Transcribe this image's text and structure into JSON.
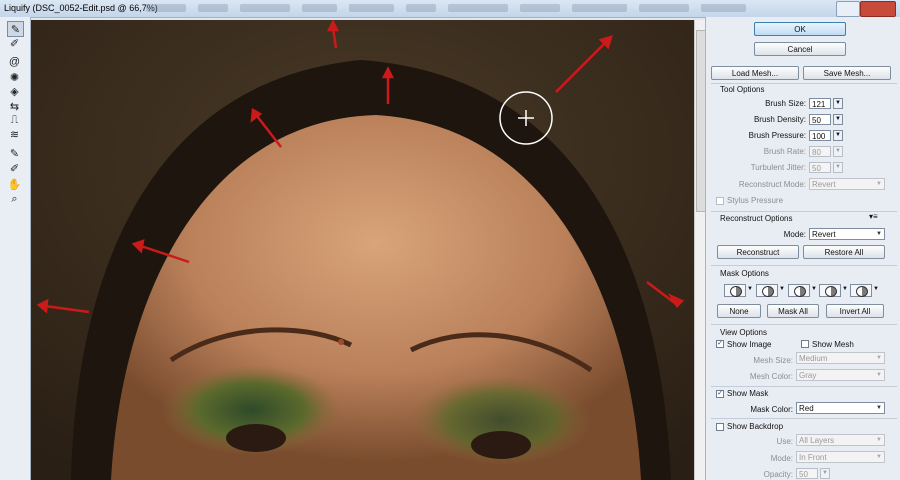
{
  "window": {
    "title": "Liquify (DSC_0052-Edit.psd @ 66,7%)"
  },
  "tools": [
    "forward-warp-icon",
    "reconstruct-icon",
    "twirl-icon",
    "pucker-icon",
    "bloat-icon",
    "push-left-icon",
    "mirror-icon",
    "turbulence-icon",
    "freeze-mask-icon",
    "thaw-mask-icon",
    "hand-icon",
    "zoom-icon"
  ],
  "actions": {
    "ok": "OK",
    "cancel": "Cancel",
    "load_mesh": "Load Mesh...",
    "save_mesh": "Save Mesh..."
  },
  "tool_options": {
    "heading": "Tool Options",
    "brush_size_label": "Brush Size:",
    "brush_size": "121",
    "brush_density_label": "Brush Density:",
    "brush_density": "50",
    "brush_pressure_label": "Brush Pressure:",
    "brush_pressure": "100",
    "brush_rate_label": "Brush Rate:",
    "brush_rate": "80",
    "turbulent_jitter_label": "Turbulent Jitter:",
    "turbulent_jitter": "50",
    "reconstruct_mode_label": "Reconstruct Mode:",
    "reconstruct_mode": "Revert",
    "stylus_pressure": "Stylus Pressure"
  },
  "reconstruct_options": {
    "heading": "Reconstruct Options",
    "mode_label": "Mode:",
    "mode": "Revert",
    "reconstruct": "Reconstruct",
    "restore_all": "Restore All"
  },
  "mask_options": {
    "heading": "Mask Options",
    "none": "None",
    "mask_all": "Mask All",
    "invert_all": "Invert All"
  },
  "view_options": {
    "heading": "View Options",
    "show_image": "Show Image",
    "show_mesh": "Show Mesh",
    "mesh_size_label": "Mesh Size:",
    "mesh_size": "Medium",
    "mesh_color_label": "Mesh Color:",
    "mesh_color": "Gray",
    "show_mask": "Show Mask",
    "mask_color_label": "Mask Color:",
    "mask_color": "Red",
    "show_backdrop": "Show Backdrop",
    "use_label": "Use:",
    "use": "All Layers",
    "mode_label": "Mode:",
    "mode": "In Front",
    "opacity_label": "Opacity:",
    "opacity": "50"
  },
  "colors": {
    "ui_bg": "#e8edf3",
    "accent": "#3c7fb1",
    "annotation_arrow": "#cc1a1a"
  }
}
